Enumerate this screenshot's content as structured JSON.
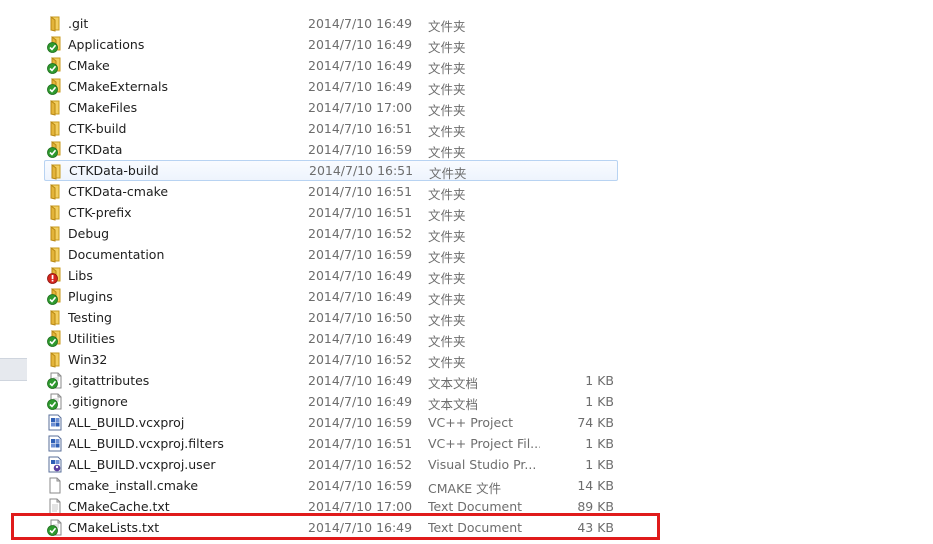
{
  "files": [
    {
      "name": ".git",
      "date": "2014/7/10 16:49",
      "type": "文件夹",
      "size": "",
      "icon": "folder-icon"
    },
    {
      "name": "Applications",
      "date": "2014/7/10 16:49",
      "type": "文件夹",
      "size": "",
      "icon": "folder-check-icon"
    },
    {
      "name": "CMake",
      "date": "2014/7/10 16:49",
      "type": "文件夹",
      "size": "",
      "icon": "folder-check-icon"
    },
    {
      "name": "CMakeExternals",
      "date": "2014/7/10 16:49",
      "type": "文件夹",
      "size": "",
      "icon": "folder-check-icon"
    },
    {
      "name": "CMakeFiles",
      "date": "2014/7/10 17:00",
      "type": "文件夹",
      "size": "",
      "icon": "folder-icon"
    },
    {
      "name": "CTK-build",
      "date": "2014/7/10 16:51",
      "type": "文件夹",
      "size": "",
      "icon": "folder-icon"
    },
    {
      "name": "CTKData",
      "date": "2014/7/10 16:59",
      "type": "文件夹",
      "size": "",
      "icon": "folder-check-icon"
    },
    {
      "name": "CTKData-build",
      "date": "2014/7/10 16:51",
      "type": "文件夹",
      "size": "",
      "icon": "folder-icon",
      "selected": true
    },
    {
      "name": "CTKData-cmake",
      "date": "2014/7/10 16:51",
      "type": "文件夹",
      "size": "",
      "icon": "folder-icon"
    },
    {
      "name": "CTK-prefix",
      "date": "2014/7/10 16:51",
      "type": "文件夹",
      "size": "",
      "icon": "folder-icon"
    },
    {
      "name": "Debug",
      "date": "2014/7/10 16:52",
      "type": "文件夹",
      "size": "",
      "icon": "folder-icon"
    },
    {
      "name": "Documentation",
      "date": "2014/7/10 16:59",
      "type": "文件夹",
      "size": "",
      "icon": "folder-icon"
    },
    {
      "name": "Libs",
      "date": "2014/7/10 16:49",
      "type": "文件夹",
      "size": "",
      "icon": "folder-conflict-icon"
    },
    {
      "name": "Plugins",
      "date": "2014/7/10 16:49",
      "type": "文件夹",
      "size": "",
      "icon": "folder-check-icon"
    },
    {
      "name": "Testing",
      "date": "2014/7/10 16:50",
      "type": "文件夹",
      "size": "",
      "icon": "folder-icon"
    },
    {
      "name": "Utilities",
      "date": "2014/7/10 16:49",
      "type": "文件夹",
      "size": "",
      "icon": "folder-check-icon"
    },
    {
      "name": "Win32",
      "date": "2014/7/10 16:52",
      "type": "文件夹",
      "size": "",
      "icon": "folder-icon"
    },
    {
      "name": ".gitattributes",
      "date": "2014/7/10 16:49",
      "type": "文本文档",
      "size": "1 KB",
      "icon": "text-file-check-icon"
    },
    {
      "name": ".gitignore",
      "date": "2014/7/10 16:49",
      "type": "文本文档",
      "size": "1 KB",
      "icon": "text-file-check-icon"
    },
    {
      "name": "ALL_BUILD.vcxproj",
      "date": "2014/7/10 16:59",
      "type": "VC++ Project",
      "size": "74 KB",
      "icon": "vcxproj-file-icon"
    },
    {
      "name": "ALL_BUILD.vcxproj.filters",
      "date": "2014/7/10 16:51",
      "type": "VC++ Project Fil...",
      "size": "1 KB",
      "icon": "vcxproj-file-icon"
    },
    {
      "name": "ALL_BUILD.vcxproj.user",
      "date": "2014/7/10 16:52",
      "type": "Visual Studio Pr...",
      "size": "1 KB",
      "icon": "vs-user-file-icon"
    },
    {
      "name": "cmake_install.cmake",
      "date": "2014/7/10 16:59",
      "type": "CMAKE 文件",
      "size": "14 KB",
      "icon": "generic-file-icon"
    },
    {
      "name": "CMakeCache.txt",
      "date": "2014/7/10 17:00",
      "type": "Text Document",
      "size": "89 KB",
      "icon": "text-file-icon"
    },
    {
      "name": "CMakeLists.txt",
      "date": "2014/7/10 16:49",
      "type": "Text Document",
      "size": "43 KB",
      "icon": "text-file-check-icon"
    }
  ]
}
